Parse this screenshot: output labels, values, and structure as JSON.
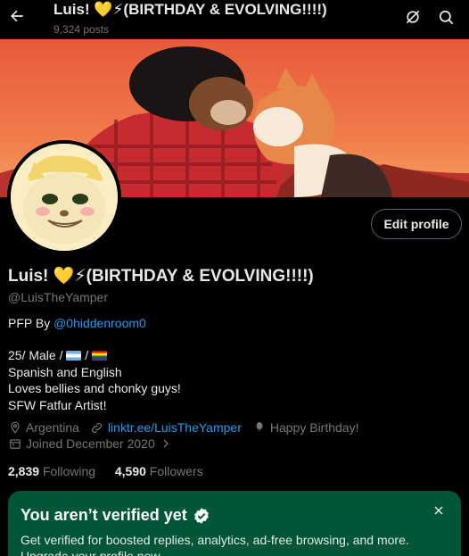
{
  "header": {
    "title": "Luis! 💛⚡(BIRTHDAY & EVOLVING!!!!)",
    "posts_count": "9,324 posts"
  },
  "profile": {
    "name": "Luis! 💛⚡(BIRTHDAY & EVOLVING!!!!)",
    "handle": "@LuisTheYamper",
    "edit_label": "Edit profile",
    "pfp_prefix": "PFP By ",
    "pfp_link": "@0hiddenroom0",
    "bio_line1_prefix": "25/ Male / ",
    "bio_line1_sep": " / ",
    "bio_line2": "Spanish and English",
    "bio_line3": "Loves bellies and chonky guys!",
    "bio_line4": "SFW Fatfur Artist!",
    "location": "Argentina",
    "website": "linktr.ee/LuisTheYamper",
    "birthday": "Happy Birthday!",
    "joined": "Joined December 2020",
    "following_count": "2,839",
    "following_label": "Following",
    "followers_count": "4,590",
    "followers_label": "Followers"
  },
  "verify_card": {
    "title": "You aren’t verified yet",
    "text": "Get verified for boosted replies, analytics, ad-free browsing, and more. Upgrade your profile now."
  },
  "colors": {
    "background": "#000000",
    "accent": "#1d9bf0",
    "muted": "#71767b",
    "verify_bg": "#00563a"
  }
}
